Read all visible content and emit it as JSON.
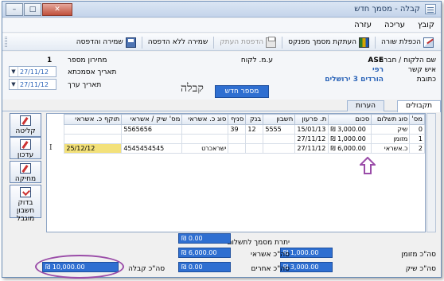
{
  "window": {
    "title": "קבלה - מסמך חדש",
    "btn_min": "–",
    "btn_max": "□",
    "btn_close": "✕"
  },
  "menu": [
    "קובץ",
    "עריכה",
    "עזרה"
  ],
  "toolbar": {
    "copy_row": "הכפלת שורה",
    "multi_copy": "העתקת מסמך מפנקס",
    "print_copy": "הדפסת העתק",
    "save_no_print": "שמירה ללא הדפסה",
    "save_print": "שמירה והדפסה"
  },
  "header": {
    "customer_label": "שם הלקוח / חברה",
    "customer_value": "ASE",
    "contact_label": "איש קשר",
    "contact_value": "רפי",
    "address_label": "כתובת",
    "address_value": "הורדים 3 ירושלים",
    "vat_label": "ע.מ. לקוח",
    "pricelist_label": "מחירון מספר",
    "pricelist_value": "1",
    "ref_date_label": "תאריך אסמכתא",
    "ref_date_value": "27/11/12",
    "value_date_label": "תאריך ערך",
    "value_date_value": "27/11/12",
    "doc_type": "קבלה",
    "doc_number": "מספר חדש"
  },
  "tabs": [
    "תקבולים",
    "הערות"
  ],
  "grid": {
    "columns": [
      "מס'",
      "סוג תשלום",
      "סכום",
      "ת. פרעון",
      "חשבון",
      "בנק",
      "סניף",
      "סוג כ. אשראי",
      "מס' שיק / אשראי",
      "תוקף כ. אשראי"
    ],
    "rows": [
      [
        "0",
        "שיק",
        "₪ 3,000.00",
        "15/01/13",
        "5555",
        "12",
        "39",
        "",
        "5565656",
        ""
      ],
      [
        "1",
        "מזומן",
        "₪ 1,000.00",
        "27/11/12",
        "",
        "",
        "",
        "",
        "",
        ""
      ],
      [
        "2",
        "כ.אשראי",
        "₪ 6,000.00",
        "27/11/12",
        "",
        "",
        "",
        "ישראכרט",
        "4545454545",
        "25/12/12"
      ]
    ]
  },
  "side_buttons": {
    "receipt": "קליטה",
    "update": "עדכון",
    "delete": "מחיקה",
    "check_line1": "בדוק",
    "check_line2": "חשבון",
    "check_line3": "מוגבל"
  },
  "totals": {
    "balance_label": "יתרת מסמך לתשלום",
    "balance_value": "₪ 0.00",
    "cash_label": "סה\"כ מזומן",
    "cash_value": "₪ 1,000.00",
    "credit_label": "סה\"כ אשראי",
    "credit_value": "₪ 6,000.00",
    "check_label": "סה\"כ שיק",
    "check_value": "₪ 3,000.00",
    "other_label": "סה\"כ אחרים",
    "other_value": "₪ 0.00",
    "receipt_total_label": "סה\"כ קבלה",
    "receipt_total_value": "₪ 10,000.00"
  },
  "colors": {
    "accent": "#2f6fd1",
    "annotation": "#9a4ca8",
    "highlight": "#f3e17a"
  }
}
